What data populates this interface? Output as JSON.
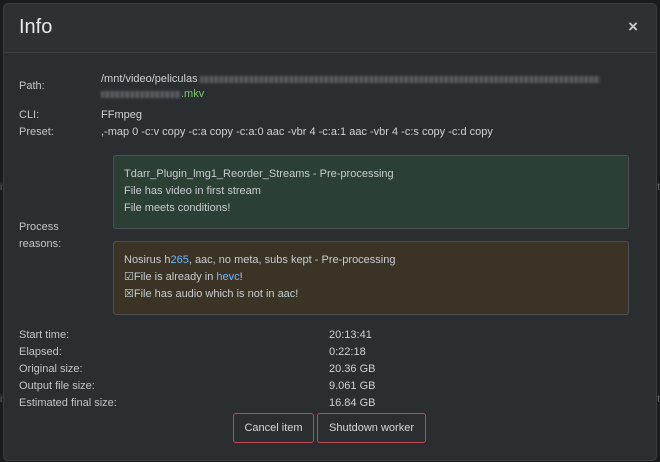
{
  "dialog": {
    "title": "Info",
    "close_glyph": "×"
  },
  "info": {
    "path_label": "Path:",
    "path_prefix": "/mnt/video/peliculas",
    "path_suffix": ".mkv",
    "cli_label": "CLI:",
    "cli_value": "FFmpeg",
    "preset_label": "Preset:",
    "preset_value": ",-map 0 -c:v copy -c:a copy -c:a:0 aac -vbr 4 -c:a:1 aac -vbr 4 -c:s copy -c:d copy",
    "process_label_1": "Process",
    "process_label_2": "reasons:"
  },
  "reasons": [
    {
      "title": "Tdarr_Plugin_lmg1_Reorder_Streams - Pre-processing",
      "line1": "File has video in first stream",
      "line2": "File meets conditions!"
    },
    {
      "title_pre": "Nosirus h",
      "title_hl": "265",
      "title_post": ", aac, no meta, subs kept - Pre-processing",
      "check_icon": "☑",
      "line1_pre": "File is already in ",
      "line1_hl": "hevc",
      "line1_post": "!",
      "cross_icon": "☒",
      "line2": "File has audio which is not in aac!"
    }
  ],
  "stats": [
    {
      "label": "Start time:",
      "value": "20:13:41"
    },
    {
      "label": "Elapsed:",
      "value": "0:22:18"
    },
    {
      "label": "Original size:",
      "value": "20.36 GB"
    },
    {
      "label": "Output file size:",
      "value": "9.061 GB"
    },
    {
      "label": "Estimated final size:",
      "value": "16.84 GB"
    }
  ],
  "buttons": {
    "cancel": "Cancel item",
    "shutdown": "Shutdown worker"
  },
  "backdrop": {
    "left_mark": "it",
    "right_mark": "it"
  },
  "colors": {
    "accent_border": "#c24a55",
    "green_box": "#2c3f35",
    "brown_box": "#3a3326",
    "highlight_blue": "#6fb7ff",
    "path_green": "#7cc36b"
  }
}
